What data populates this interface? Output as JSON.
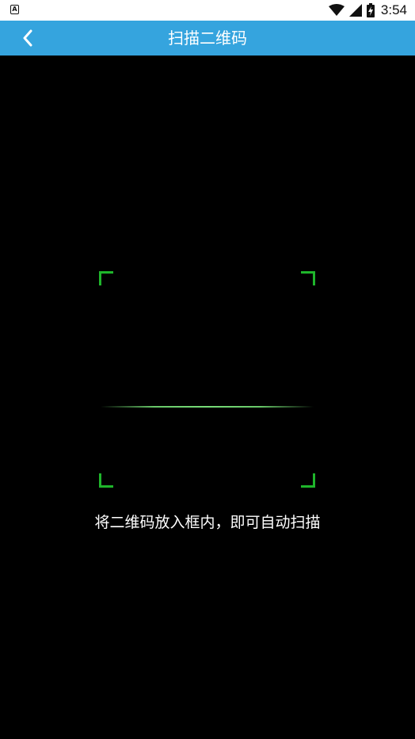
{
  "status_bar": {
    "left_icon": "A",
    "time": "3:54",
    "icons": [
      "wifi-icon",
      "signal-icon",
      "battery-charging-icon"
    ]
  },
  "app_bar": {
    "title": "扫描二维码",
    "back_icon": "chevron-left-icon",
    "background_color": "#35a4de"
  },
  "scanner": {
    "hint": "将二维码放入框内，即可自动扫描",
    "corner_color": "#1fb52b"
  }
}
